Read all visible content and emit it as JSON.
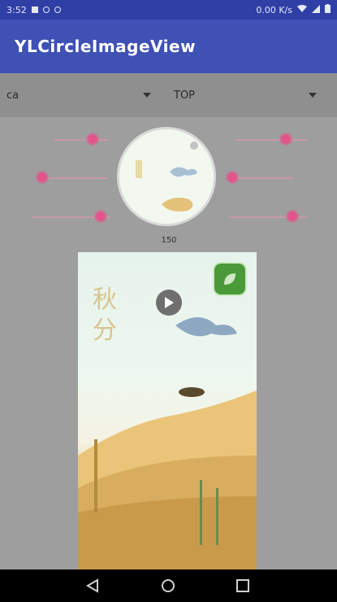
{
  "status_bar": {
    "time": "3:52",
    "right_text": "0.00 K/s",
    "icons": [
      "notification-icon",
      "settings-icon",
      "wifi-icon",
      "signal-icon",
      "battery-icon"
    ]
  },
  "app_bar": {
    "title": "YLCircleImageView"
  },
  "controls": {
    "left_spinner": {
      "selected": "ca"
    },
    "right_spinner": {
      "selected": "TOP"
    }
  },
  "preview": {
    "size_label": "150"
  },
  "image_panel": {
    "calligraphy": "秋分",
    "badge_icon": "leaf-badge-icon"
  },
  "colors": {
    "status_bar": "#2f3fa6",
    "app_bar": "#3f51b5",
    "background": "#9e9e9e",
    "accent_dot": "#e2548a"
  }
}
